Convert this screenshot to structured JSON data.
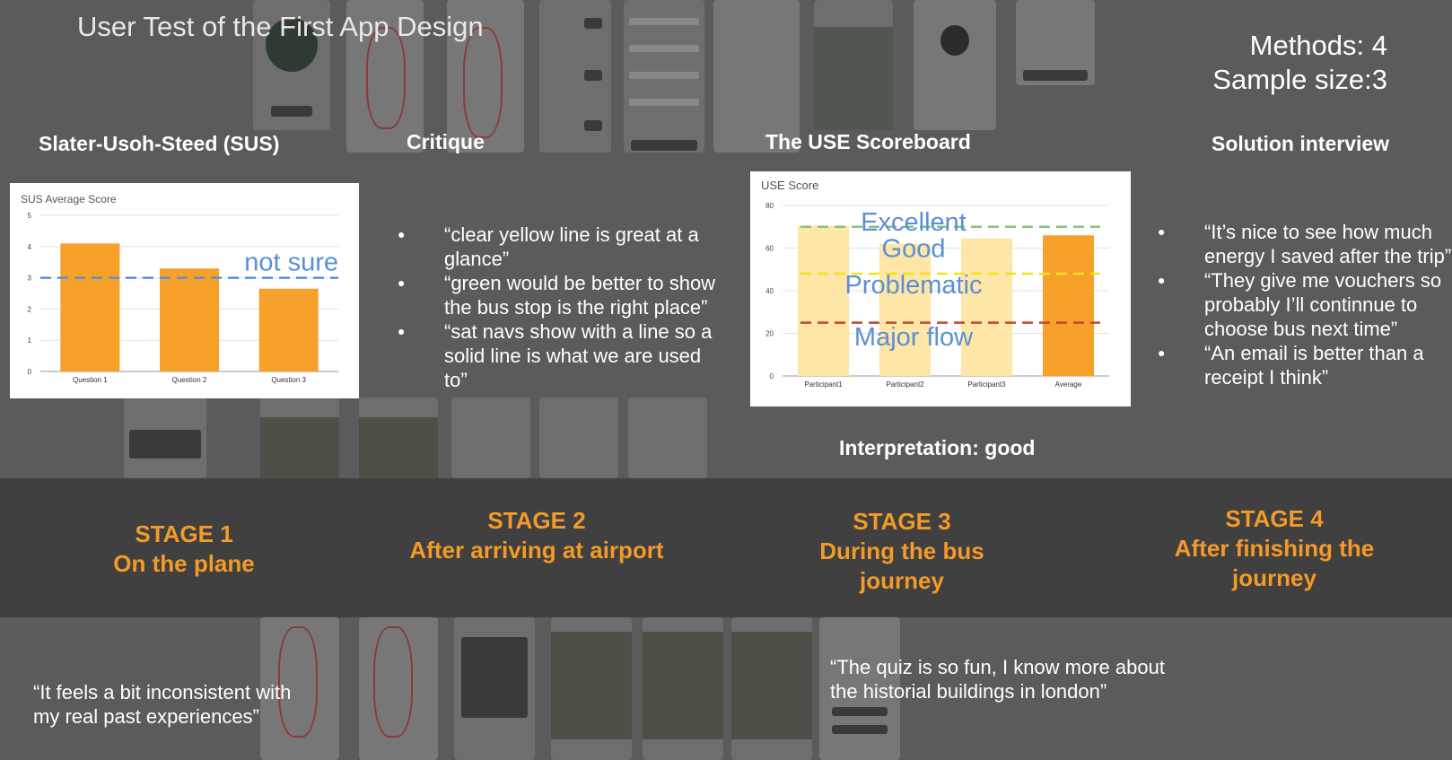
{
  "title": "User Test of the First App Design",
  "methods": {
    "line1": "Methods: 4",
    "line2": "Sample size:3"
  },
  "headers": {
    "sus": "Slater-Usoh-Steed (SUS)",
    "critique": "Critique",
    "use": "The USE Scoreboard",
    "interview": "Solution interview"
  },
  "critique_quotes": [
    "“clear yellow line is great at a glance”",
    "“green would be better to show the bus stop is the right place”",
    "“sat navs show with a line so a solid line is what we are used to”"
  ],
  "interview_quotes": [
    "“It’s nice to see how much energy I saved after the trip”",
    "“They give me vouchers so probably I’ll continnue to choose bus next time”",
    "“An email is better than a receipt I think”"
  ],
  "interpretation": "Interpretation: good",
  "stages": [
    {
      "num": "STAGE 1",
      "desc": "On the plane"
    },
    {
      "num": "STAGE 2",
      "desc": "After arriving at airport"
    },
    {
      "num": "STAGE 3",
      "desc": "During the bus journey"
    },
    {
      "num": "STAGE 4",
      "desc": "After finishing the journey"
    }
  ],
  "bottom_quotes": {
    "stage1": "“It feels a bit inconsistent with my real past experiences”",
    "stage3": "“The quiz is so fun, I know more about the historial buildings in london”"
  },
  "colors": {
    "bar": "#f7a12a",
    "bar_light": "#fde6a6",
    "accent": "#f39a28",
    "threshold_blue": "#5b8fd6"
  },
  "chart_data": [
    {
      "type": "bar",
      "title": "SUS Average Score",
      "categories": [
        "Question 1",
        "Question 2",
        "Question 3"
      ],
      "values": [
        4.1,
        3.3,
        2.65
      ],
      "ylim": [
        0,
        5
      ],
      "yticks": [
        0,
        1,
        2,
        3,
        4,
        5
      ],
      "threshold": {
        "value": 3,
        "label": "not sure",
        "color": "#5b8fd6"
      },
      "grid": true
    },
    {
      "type": "bar",
      "title": "USE Score",
      "categories": [
        "Participant1",
        "Participant2",
        "Participant3",
        "Average"
      ],
      "values": [
        70.5,
        62,
        64.5,
        66
      ],
      "bar_colors": [
        "#fde6a6",
        "#fde6a6",
        "#fde6a6",
        "#f7a12a"
      ],
      "ylim": [
        0,
        80
      ],
      "yticks": [
        0,
        20,
        40,
        60,
        80
      ],
      "grid": true,
      "thresholds": [
        {
          "value": 70,
          "color": "#8bc17c"
        },
        {
          "value": 48,
          "color": "#f2e21c"
        },
        {
          "value": 25,
          "color": "#c8452a"
        }
      ],
      "bands": [
        "Excellent",
        "Good",
        "Problematic",
        "Major flow"
      ]
    }
  ]
}
